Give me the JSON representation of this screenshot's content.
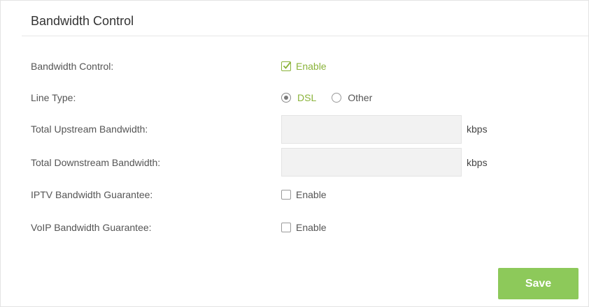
{
  "panel": {
    "title": "Bandwidth Control"
  },
  "rows": {
    "bandwidth_control": {
      "label": "Bandwidth Control:",
      "option": "Enable",
      "checked": true
    },
    "line_type": {
      "label": "Line Type:",
      "options": [
        "DSL",
        "Other"
      ],
      "selected": "DSL"
    },
    "upstream": {
      "label": "Total Upstream Bandwidth:",
      "value": "",
      "unit": "kbps"
    },
    "downstream": {
      "label": "Total Downstream Bandwidth:",
      "value": "",
      "unit": "kbps"
    },
    "iptv": {
      "label": "IPTV Bandwidth Guarantee:",
      "option": "Enable",
      "checked": false
    },
    "voip": {
      "label": "VoIP Bandwidth Guarantee:",
      "option": "Enable",
      "checked": false
    }
  },
  "actions": {
    "save_label": "Save"
  },
  "colors": {
    "accent": "#8ab33a",
    "button": "#8dc95a",
    "field_bg": "#f2f2f2"
  }
}
